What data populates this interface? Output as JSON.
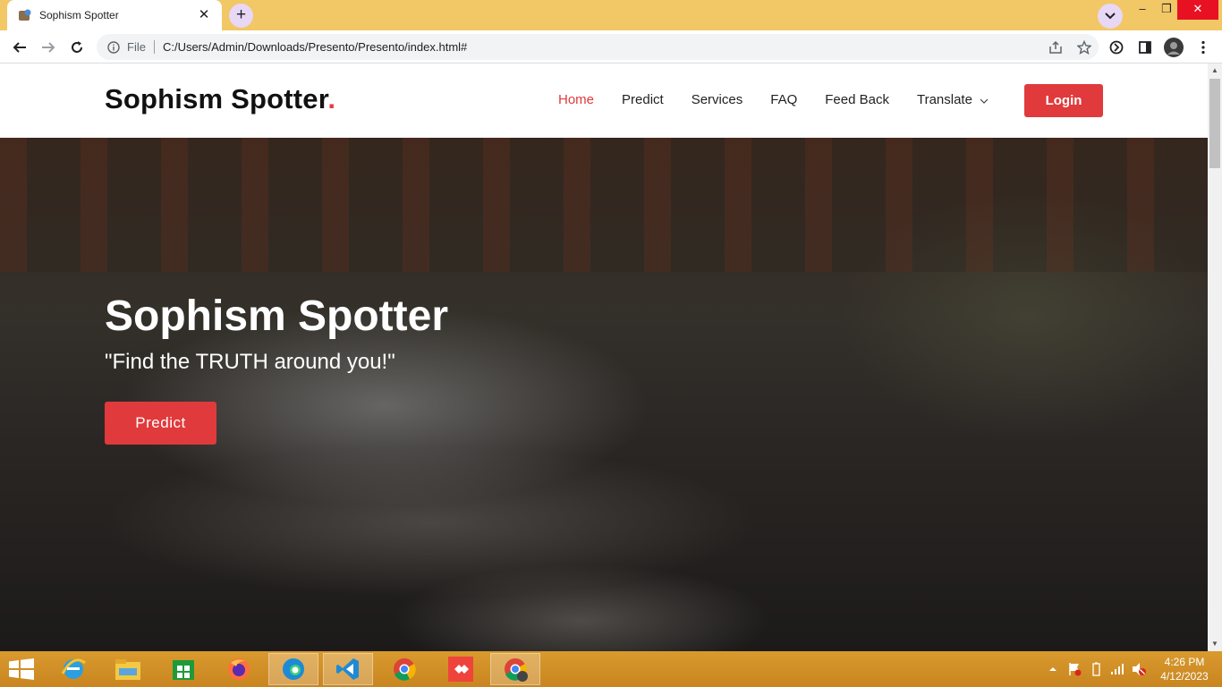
{
  "browser": {
    "tab_title": "Sophism Spotter",
    "tab_close": "✕",
    "new_tab": "+",
    "omnibox_scheme": "File",
    "omnibox_url": "C:/Users/Admin/Downloads/Presento/Presento/index.html#",
    "window_controls": {
      "minimize": "–",
      "maximize": "❐",
      "close": "✕"
    }
  },
  "site": {
    "logo_text": "Sophism Spotter",
    "logo_dot": ".",
    "nav": [
      {
        "label": "Home",
        "active": true
      },
      {
        "label": "Predict"
      },
      {
        "label": "Services"
      },
      {
        "label": "FAQ"
      },
      {
        "label": "Feed Back"
      },
      {
        "label": "Translate"
      }
    ],
    "login_label": "Login"
  },
  "hero": {
    "title": "Sophism Spotter",
    "subtitle": "\"Find the TRUTH around you!\"",
    "cta_label": "Predict"
  },
  "taskbar": {
    "apps": [
      "internet-explorer",
      "file-explorer",
      "store",
      "firefox",
      "edge",
      "vscode",
      "chrome",
      "anydesk",
      "chrome-active"
    ],
    "time": "4:26 PM",
    "date": "4/12/2023"
  },
  "colors": {
    "accent": "#e03a3c",
    "tabstrip": "#f2c766",
    "taskbar": "#d99a2e"
  }
}
